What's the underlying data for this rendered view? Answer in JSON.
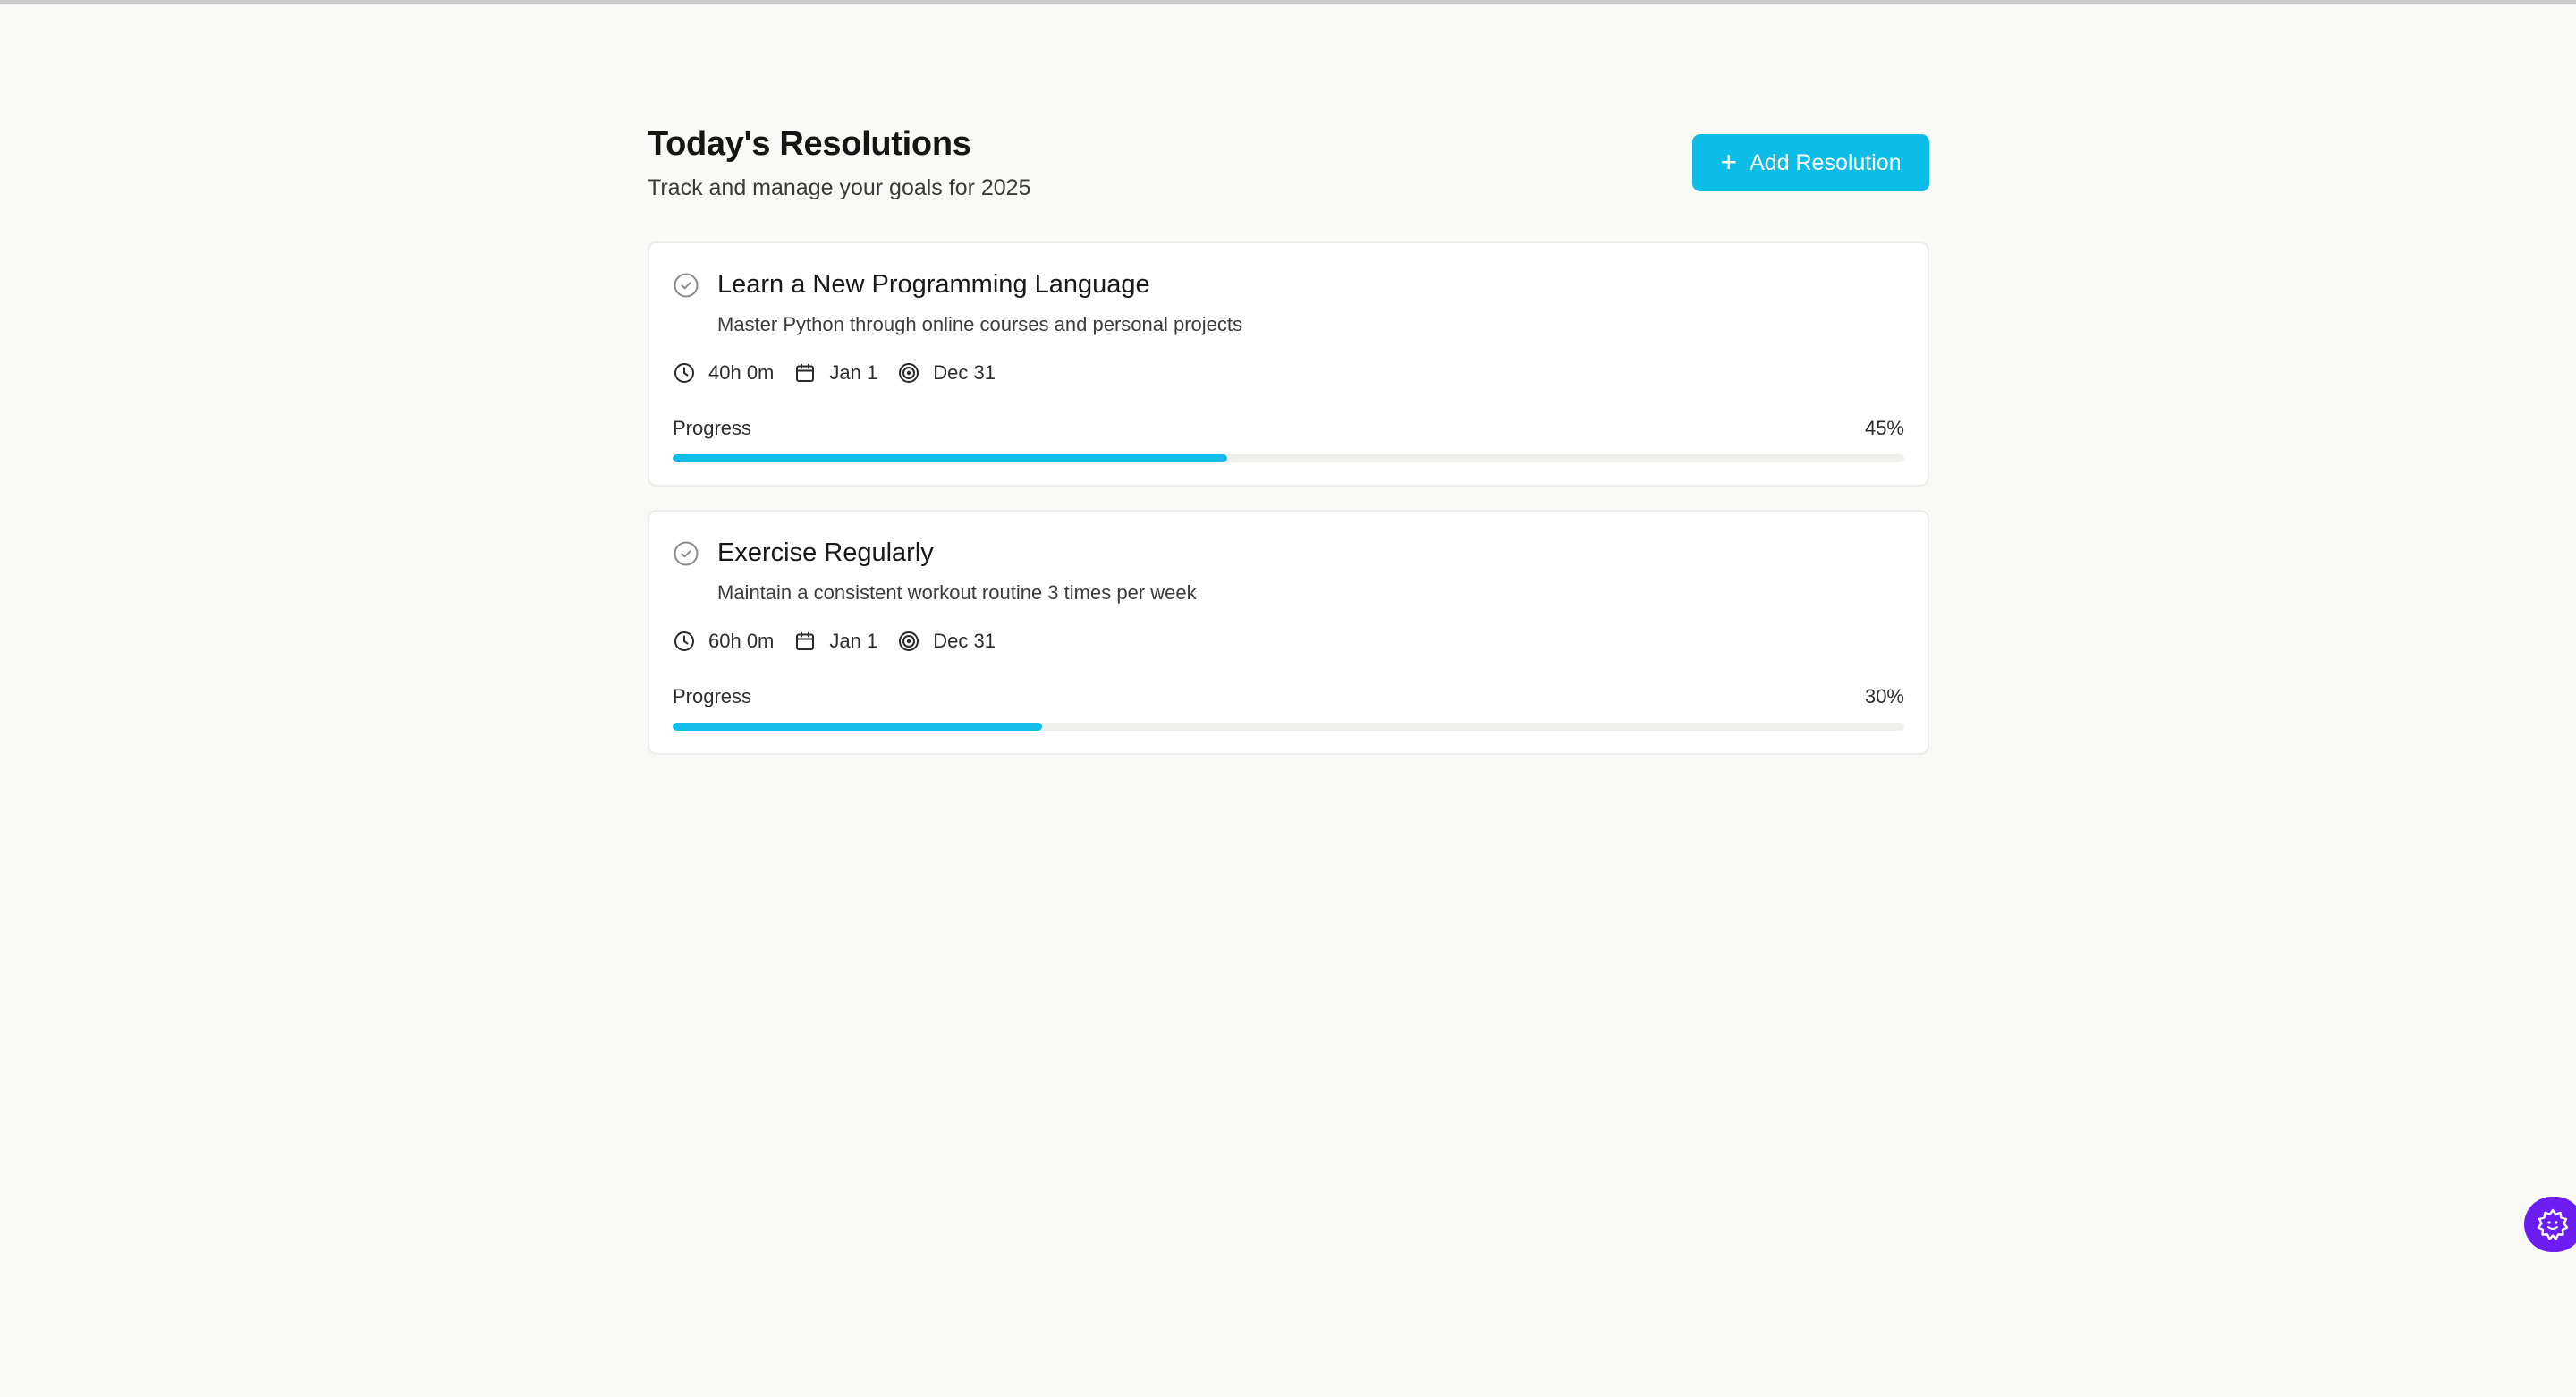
{
  "header": {
    "title": "Today's Resolutions",
    "subtitle": "Track and manage your goals for 2025",
    "add_button_label": "Add Resolution"
  },
  "resolutions": [
    {
      "title": "Learn a New Programming Language",
      "description": "Master Python through online courses and personal projects",
      "time": "40h 0m",
      "start": "Jan 1",
      "target": "Dec 31",
      "progress_label": "Progress",
      "progress_text": "45%",
      "progress_value": 45
    },
    {
      "title": "Exercise Regularly",
      "description": "Maintain a consistent workout routine 3 times per week",
      "time": "60h 0m",
      "start": "Jan 1",
      "target": "Dec 31",
      "progress_label": "Progress",
      "progress_text": "30%",
      "progress_value": 30
    }
  ],
  "colors": {
    "accent": "#0cbde8",
    "background": "#f9f9f8",
    "fab": "#6b1df2"
  },
  "icons": {
    "add": "plus-icon",
    "status": "check-circle-icon",
    "time": "clock-icon",
    "start": "calendar-icon",
    "target": "target-icon",
    "fab": "gear-icon"
  }
}
